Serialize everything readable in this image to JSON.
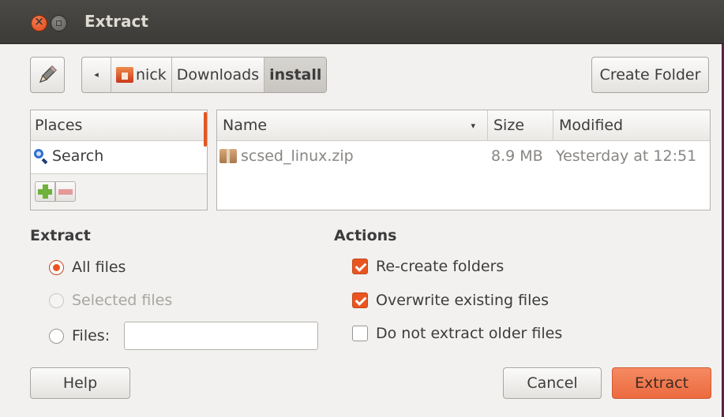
{
  "window": {
    "title": "Extract"
  },
  "toolbar": {
    "path": [
      "nick",
      "Downloads",
      "install"
    ],
    "create_folder_label": "Create Folder"
  },
  "places": {
    "header": "Places",
    "items": [
      {
        "label": "Search",
        "icon": "search-icon"
      }
    ]
  },
  "files": {
    "columns": {
      "name": "Name",
      "size": "Size",
      "modified": "Modified"
    },
    "rows": [
      {
        "name": "scsed_linux.zip",
        "size": "8.9 MB",
        "modified": "Yesterday at 12:51",
        "icon": "zip-archive-icon"
      }
    ]
  },
  "extract": {
    "title": "Extract",
    "options": {
      "all_files": "All files",
      "selected_files": "Selected files",
      "files": "Files:"
    },
    "selected_option": "all_files",
    "files_input_value": ""
  },
  "actions": {
    "title": "Actions",
    "recreate_folders": {
      "label": "Re-create folders",
      "checked": true
    },
    "overwrite": {
      "label": "Overwrite existing files",
      "checked": true
    },
    "no_older": {
      "label": "Do not extract older files",
      "checked": false
    }
  },
  "buttons": {
    "help": "Help",
    "cancel": "Cancel",
    "extract": "Extract"
  },
  "colors": {
    "accent": "#e95420",
    "titlebar": "#3c3b37"
  }
}
